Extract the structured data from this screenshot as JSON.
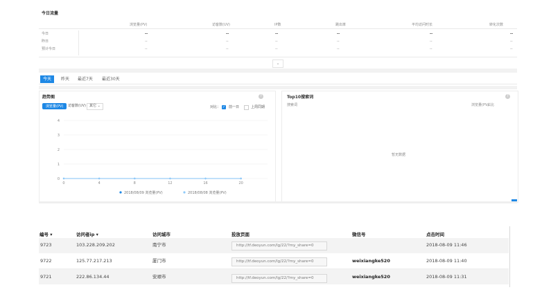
{
  "today_stats": {
    "title": "今日流量",
    "headers": [
      "浏览量(PV)",
      "访客数(UV)",
      "IP数",
      "跳出率",
      "平均访问时长",
      "转化次数"
    ],
    "rows": [
      {
        "label": "今日",
        "values": [
          "--",
          "--",
          "--",
          "--",
          "--",
          "--"
        ]
      },
      {
        "label": "昨日",
        "values": [
          "--",
          "--",
          "--",
          "--",
          "--",
          "--"
        ]
      },
      {
        "label": "预计今日",
        "values": [
          "--",
          "--",
          "--",
          "--",
          "--",
          "--"
        ]
      }
    ]
  },
  "date_tabs": {
    "items": [
      "今天",
      "昨天",
      "最近7天",
      "最近30天"
    ],
    "active_index": 0
  },
  "trend": {
    "title": "趋势图",
    "metric_tabs": [
      "浏览量(PV)",
      "访客数(UV)",
      "其它"
    ],
    "compare_label": "对比：",
    "compare_options": [
      "前一日",
      "上周同期"
    ]
  },
  "top10": {
    "title": "Top10搜索词",
    "col_left": "搜索词",
    "col_right_1": "浏览量(PV)",
    "col_right_2": "占比",
    "empty_text": "暂无数据"
  },
  "chart_data": {
    "type": "line",
    "x": [
      0,
      4,
      8,
      12,
      16,
      20
    ],
    "y_ticks": [
      0,
      1,
      2,
      3,
      4
    ],
    "series": [
      {
        "name": "2018/08/09 浏览量(PV)",
        "values": [
          0,
          0,
          0,
          0,
          0,
          0
        ],
        "color": "#1e88e5"
      },
      {
        "name": "2018/08/08 浏览量(PV)",
        "values": [
          0,
          0,
          0,
          0,
          0,
          0
        ],
        "color": "#90caf9"
      }
    ],
    "ylim": [
      0,
      4
    ],
    "xlim": [
      0,
      23
    ]
  },
  "visitors_table": {
    "headers": [
      "编号",
      "访问者ip",
      "访问城市",
      "投放页面",
      "微信号",
      "点击时间"
    ],
    "rows": [
      {
        "id": "9723",
        "ip": "103.228.209.202",
        "city": "南宁市",
        "page": "http://tf.deoyun.com/lg/22/?my_share=0",
        "wechat": "",
        "time": "2018-08-09 11:46"
      },
      {
        "id": "9722",
        "ip": "125.77.217.213",
        "city": "厦门市",
        "page": "http://tf.deoyun.com/lg/22/?my_share=0",
        "wechat": "weixiangke520",
        "time": "2018-08-09 11:40"
      },
      {
        "id": "9721",
        "ip": "222.86.134.44",
        "city": "安顺市",
        "page": "http://tf.deoyun.com/lg/22/?my_share=0",
        "wechat": "weixiangke520",
        "time": "2018-08-09 11:31"
      }
    ]
  },
  "colors": {
    "accent": "#1e88e5",
    "accent_light": "#90caf9",
    "grid": "#eeeeee"
  }
}
